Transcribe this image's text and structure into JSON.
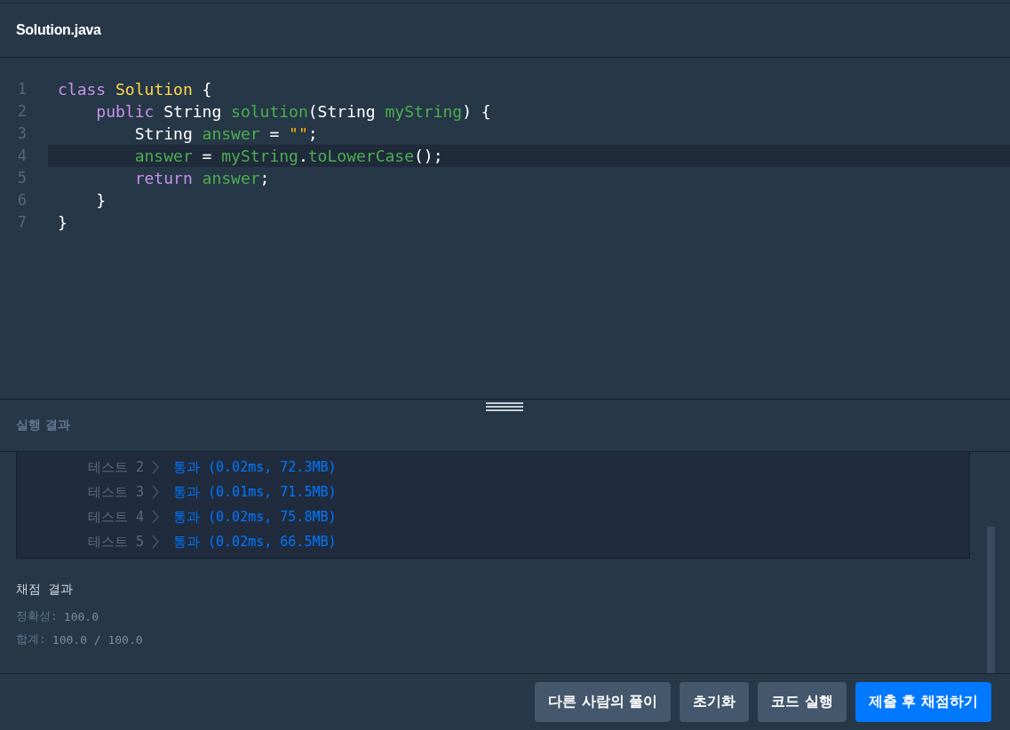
{
  "editor": {
    "filename": "Solution.java",
    "lines": [
      {
        "number": "1",
        "current": false,
        "tokens": [
          {
            "text": "class ",
            "kind": "keyword"
          },
          {
            "text": "Solution",
            "kind": "type"
          },
          {
            "text": " {",
            "kind": "plain"
          }
        ]
      },
      {
        "number": "2",
        "current": false,
        "tokens": [
          {
            "text": "    public ",
            "kind": "keyword"
          },
          {
            "text": "String ",
            "kind": "plain"
          },
          {
            "text": "solution",
            "kind": "name"
          },
          {
            "text": "(String ",
            "kind": "plain"
          },
          {
            "text": "myString",
            "kind": "name"
          },
          {
            "text": ") {",
            "kind": "plain"
          }
        ]
      },
      {
        "number": "3",
        "current": false,
        "tokens": [
          {
            "text": "        String ",
            "kind": "plain"
          },
          {
            "text": "answer",
            "kind": "name"
          },
          {
            "text": " = ",
            "kind": "plain"
          },
          {
            "text": "\"\"",
            "kind": "string"
          },
          {
            "text": ";",
            "kind": "plain"
          }
        ]
      },
      {
        "number": "4",
        "current": true,
        "tokens": [
          {
            "text": "        answer",
            "kind": "name"
          },
          {
            "text": " = ",
            "kind": "plain"
          },
          {
            "text": "myString",
            "kind": "name"
          },
          {
            "text": ".",
            "kind": "plain"
          },
          {
            "text": "toLowerCase",
            "kind": "name"
          },
          {
            "text": "();",
            "kind": "plain"
          }
        ]
      },
      {
        "number": "5",
        "current": false,
        "tokens": [
          {
            "text": "        return ",
            "kind": "keyword"
          },
          {
            "text": "answer",
            "kind": "name"
          },
          {
            "text": ";",
            "kind": "plain"
          }
        ]
      },
      {
        "number": "6",
        "current": false,
        "tokens": [
          {
            "text": "    }",
            "kind": "plain"
          }
        ]
      },
      {
        "number": "7",
        "current": false,
        "tokens": [
          {
            "text": "}",
            "kind": "plain"
          }
        ]
      }
    ]
  },
  "results": {
    "title": "실행 결과",
    "tests": [
      {
        "label": "테스트 2",
        "result": "통과 (0.02ms, 72.3MB)"
      },
      {
        "label": "테스트 3",
        "result": "통과 (0.01ms, 71.5MB)"
      },
      {
        "label": "테스트 4",
        "result": "통과 (0.02ms, 75.8MB)"
      },
      {
        "label": "테스트 5",
        "result": "통과 (0.02ms, 66.5MB)"
      }
    ],
    "grading": {
      "title": "채점 결과",
      "rows": [
        {
          "label": "정확성:",
          "value": "100.0"
        },
        {
          "label": "합계:",
          "value": "100.0 / 100.0"
        }
      ]
    }
  },
  "buttons": [
    {
      "label": "다른 사람의 풀이",
      "kind": "secondary"
    },
    {
      "label": "초기화",
      "kind": "secondary"
    },
    {
      "label": "코드 실행",
      "kind": "secondary"
    },
    {
      "label": "제출 후 채점하기",
      "kind": "primary"
    }
  ]
}
